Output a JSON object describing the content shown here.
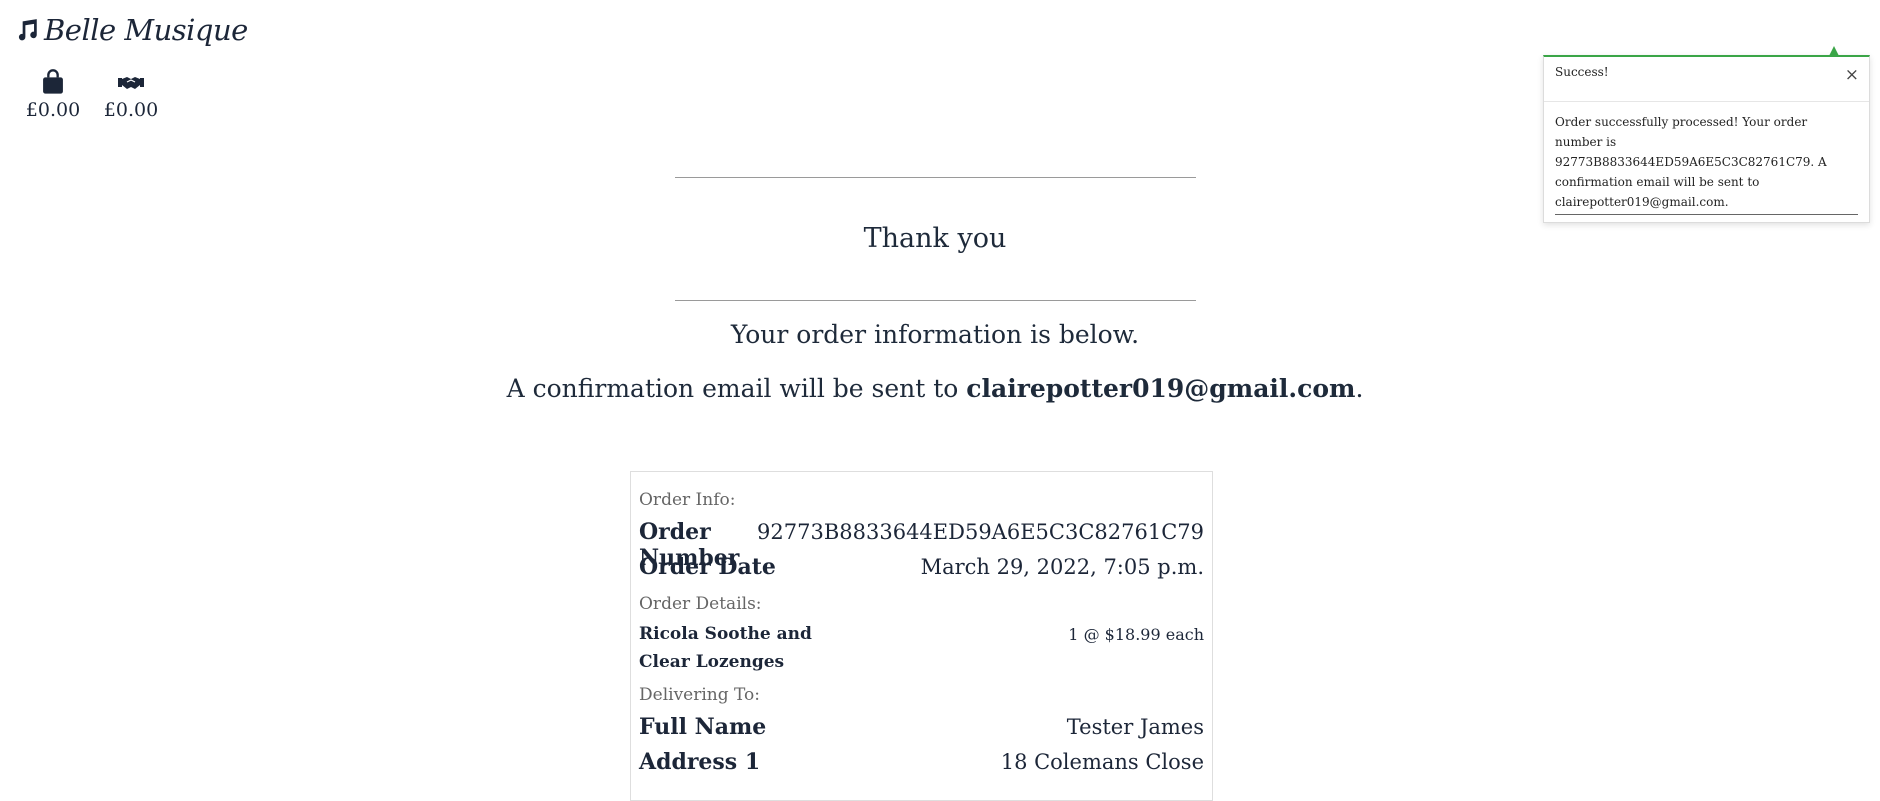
{
  "brand": {
    "name": "Belle Musique",
    "icon": "music-note-icon"
  },
  "nav": {
    "bag": {
      "icon": "shopping-bag-icon",
      "amount": "£0.00"
    },
    "deals": {
      "icon": "handshake-icon",
      "amount": "£0.00"
    }
  },
  "toast": {
    "title": "Success!",
    "close": "×",
    "message": "Order successfully processed! Your order number is 92773B8833644ED59A6E5C3C82761C79. A confirmation email will be sent to clairepotter019@gmail.com."
  },
  "thanks": {
    "heading": "Thank you",
    "info": "Your order information is below.",
    "email_prefix": "A confirmation email will be sent to ",
    "email": "clairepotter019@gmail.com",
    "email_suffix": "."
  },
  "order": {
    "info_label": "Order Info:",
    "number_label": "Order Number",
    "number_value": "92773B8833644ED59A6E5C3C82761C79",
    "date_label": "Order Date",
    "date_value": "March 29, 2022, 7:05 p.m.",
    "details_label": "Order Details:",
    "item_name_line1": "Ricola Soothe and",
    "item_name_line2": "Clear Lozenges",
    "item_qty": "1 @ $18.99 each",
    "delivering_label": "Delivering To:",
    "full_name_label": "Full Name",
    "full_name_value": "Tester James",
    "address1_label": "Address 1",
    "address1_value": "18 Colemans Close"
  },
  "colors": {
    "accent": "#3aa547",
    "text": "#1c2638"
  }
}
